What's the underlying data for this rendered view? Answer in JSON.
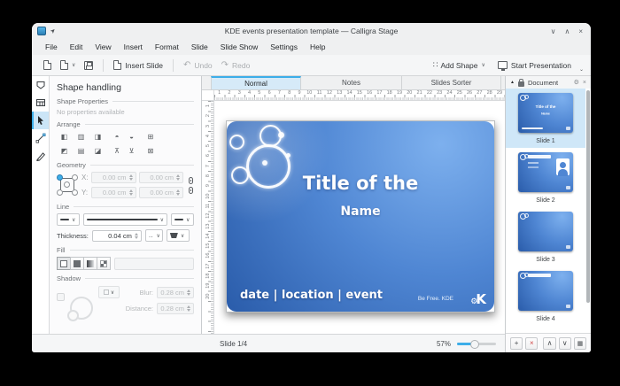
{
  "window": {
    "title": "KDE events presentation template — Calligra Stage",
    "minimize": "∨",
    "maximize": "∧",
    "close": "×"
  },
  "menu": {
    "items": [
      "File",
      "Edit",
      "View",
      "Insert",
      "Format",
      "Slide",
      "Slide Show",
      "Settings",
      "Help"
    ]
  },
  "toolbar": {
    "insert_slide_label": "Insert Slide",
    "undo_label": "Undo",
    "redo_label": "Redo",
    "add_shape_label": "Add Shape",
    "start_presentation_label": "Start Presentation"
  },
  "tools": [
    {
      "name": "create-shape-tool",
      "selected": false
    },
    {
      "name": "text-table-tool",
      "selected": false
    },
    {
      "name": "selection-tool",
      "selected": true
    },
    {
      "name": "connection-line-tool",
      "selected": false
    },
    {
      "name": "freehand-path-tool",
      "selected": false
    }
  ],
  "dock": {
    "title": "Shape handling",
    "shape_properties_label": "Shape Properties",
    "no_properties_text": "No properties available",
    "arrange_label": "Arrange",
    "arrange_icons": [
      {
        "name": "align-left-icon",
        "glyph": "◧"
      },
      {
        "name": "align-center-horizontal-icon",
        "glyph": "▥"
      },
      {
        "name": "align-right-icon",
        "glyph": "◨"
      },
      {
        "name": "raise-shape-icon",
        "glyph": "◓"
      },
      {
        "name": "lower-shape-icon",
        "glyph": "◒"
      },
      {
        "name": "group-shapes-icon",
        "glyph": "⊞"
      },
      {
        "name": "align-top-icon",
        "glyph": "◩"
      },
      {
        "name": "align-center-vertical-icon",
        "glyph": "▤"
      },
      {
        "name": "align-bottom-icon",
        "glyph": "◪"
      },
      {
        "name": "bring-to-front-icon",
        "glyph": "⊼"
      },
      {
        "name": "send-to-back-icon",
        "glyph": "⊻"
      },
      {
        "name": "ungroup-shapes-icon",
        "glyph": "⊠"
      }
    ],
    "geometry": {
      "label": "Geometry",
      "x_label": "X:",
      "y_label": "Y:",
      "x_value": "0.00 cm",
      "y_value": "0.00 cm",
      "width_value": "0.00 cm",
      "height_value": "0.00 cm"
    },
    "line": {
      "label": "Line",
      "thickness_label": "Thickness:",
      "thickness_value": "0.04 cm"
    },
    "fill": {
      "label": "Fill"
    },
    "shadow": {
      "label": "Shadow",
      "blur_label": "Blur:",
      "blur_value": "0.28 cm",
      "distance_label": "Distance:",
      "distance_value": "0.28 cm"
    }
  },
  "tabs": [
    {
      "label": "Normal",
      "active": true
    },
    {
      "label": "Notes",
      "active": false
    },
    {
      "label": "Slides Sorter",
      "active": false
    }
  ],
  "rulers": {
    "horizontal": [
      1,
      2,
      3,
      4,
      5,
      6,
      7,
      8,
      9,
      10,
      11,
      12,
      13,
      14,
      15,
      16,
      17,
      18,
      19,
      20,
      21,
      22,
      23,
      24,
      25,
      26,
      27,
      28,
      29
    ],
    "vertical": [
      1,
      2,
      3,
      4,
      5,
      6,
      7,
      8,
      9,
      10,
      11,
      12,
      13,
      14,
      15,
      16,
      17,
      18,
      19,
      20
    ]
  },
  "slide": {
    "title_line1": "Title of the",
    "title_line2": "Name",
    "footer": "date | location | event",
    "credit": "Be Free. KDE",
    "logo_letter": "K",
    "logo_gear": "⚙"
  },
  "document_panel": {
    "title": "Document",
    "slides": [
      {
        "label": "Slide 1",
        "selected": true,
        "variant": "title"
      },
      {
        "label": "Slide 2",
        "selected": false,
        "variant": "content-image"
      },
      {
        "label": "Slide 3",
        "selected": false,
        "variant": "blank"
      },
      {
        "label": "Slide 4",
        "selected": false,
        "variant": "content"
      }
    ]
  },
  "statusbar": {
    "slide_indicator": "Slide 1/4",
    "zoom_level": "57%"
  },
  "colors": {
    "accent": "#3daee9",
    "selection_bg": "#cfe7f8",
    "slide_gradient_light": "#7db0ee",
    "slide_gradient_dark": "#2a5caa"
  }
}
